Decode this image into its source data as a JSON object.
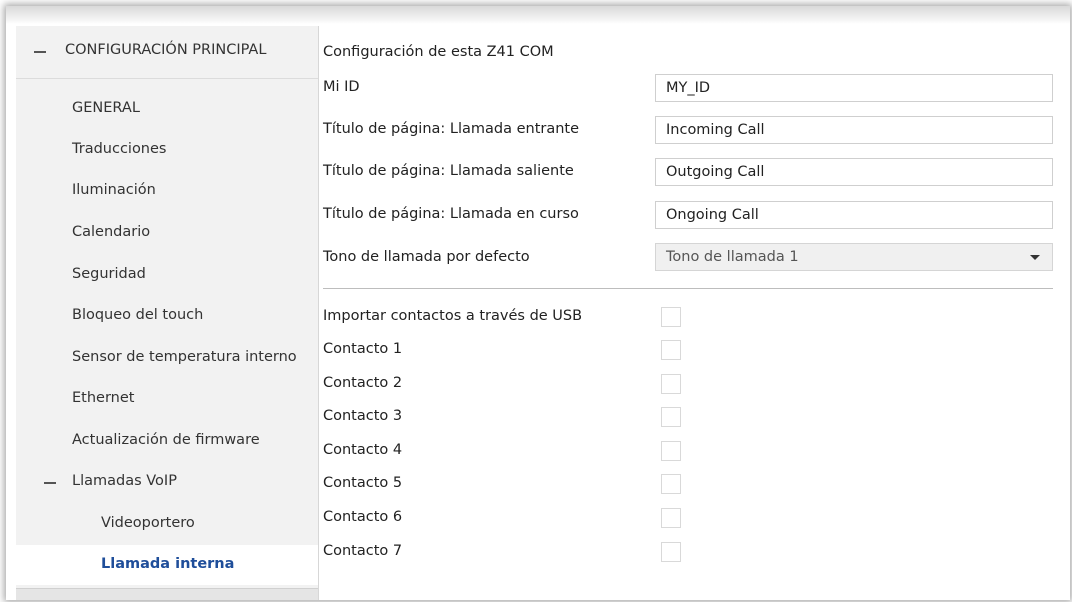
{
  "sidebar": {
    "header": "CONFIGURACIÓN PRINCIPAL",
    "items": [
      {
        "label": "GENERAL"
      },
      {
        "label": "Traducciones"
      },
      {
        "label": "Iluminación"
      },
      {
        "label": "Calendario"
      },
      {
        "label": "Seguridad"
      },
      {
        "label": "Bloqueo del touch"
      },
      {
        "label": "Sensor de temperatura interno"
      },
      {
        "label": "Ethernet"
      },
      {
        "label": "Actualización de firmware"
      },
      {
        "label": "Llamadas VoIP"
      },
      {
        "label": "Videoportero"
      },
      {
        "label": "Llamada interna"
      }
    ],
    "active_item": "Llamada interna"
  },
  "main": {
    "section_title": "Configuración de esta Z41 COM",
    "fields": [
      {
        "label": "Mi ID",
        "value": "MY_ID"
      },
      {
        "label": "Título de página: Llamada entrante",
        "value": "Incoming Call"
      },
      {
        "label": "Título de página: Llamada saliente",
        "value": "Outgoing Call"
      },
      {
        "label": "Título de página: Llamada en curso",
        "value": "Ongoing Call"
      }
    ],
    "ringtone": {
      "label": "Tono de llamada por defecto",
      "value": "Tono de llamada 1"
    },
    "checkboxes": [
      {
        "label": "Importar contactos a través de USB",
        "checked": false
      },
      {
        "label": "Contacto 1",
        "checked": false
      },
      {
        "label": "Contacto 2",
        "checked": false
      },
      {
        "label": "Contacto 3",
        "checked": false
      },
      {
        "label": "Contacto 4",
        "checked": false
      },
      {
        "label": "Contacto 5",
        "checked": false
      },
      {
        "label": "Contacto 6",
        "checked": false
      },
      {
        "label": "Contacto 7",
        "checked": false
      }
    ]
  },
  "colors": {
    "active_item": "#1f4e9a",
    "sidebar_bg": "#f2f2f2"
  }
}
